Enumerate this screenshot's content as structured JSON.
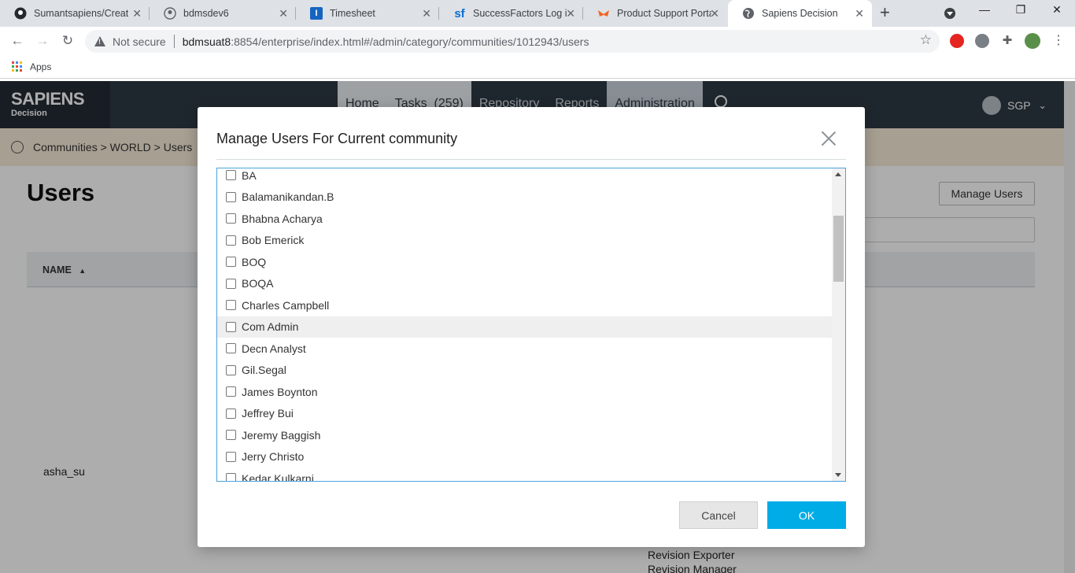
{
  "browser": {
    "tabs": [
      {
        "title": "Sumantsapiens/Create",
        "icon": "github-icon"
      },
      {
        "title": "bdmsdev6",
        "icon": "person-icon"
      },
      {
        "title": "Timesheet",
        "icon": "timesheet-icon"
      },
      {
        "title": "SuccessFactors Log in",
        "icon": "successfactors-icon"
      },
      {
        "title": "Product Support Porta",
        "icon": "support-portal-icon"
      },
      {
        "title": "Sapiens Decision",
        "icon": "globe-icon"
      }
    ],
    "address": {
      "security_label": "Not secure",
      "url_host": "bdmsuat8",
      "url_rest": ":8854/enterprise/index.html#/admin/category/communities/1012943/users"
    },
    "bookmarks": {
      "apps_label": "Apps"
    }
  },
  "app": {
    "logo_name": "SAPIENS",
    "logo_sub": "Decision",
    "nav": {
      "home": "Home",
      "tasks": "Tasks",
      "tasks_count": "(259)",
      "repository": "Repository",
      "reports": "Reports",
      "administration": "Administration"
    },
    "user_code": "SGP",
    "breadcrumb": "Communities > WORLD > Users",
    "page_title": "Users",
    "manage_users_button": "Manage Users",
    "table_header_name": "NAME",
    "row_user": "asha_su",
    "roles": [
      "Revision Exporter",
      "Revision Manager"
    ]
  },
  "modal": {
    "title": "Manage Users For Current community",
    "users": [
      {
        "name": "BA",
        "checked": false
      },
      {
        "name": "Balamanikandan.B",
        "checked": false
      },
      {
        "name": "Bhabna Acharya",
        "checked": false
      },
      {
        "name": "Bob Emerick",
        "checked": false
      },
      {
        "name": "BOQ",
        "checked": false
      },
      {
        "name": "BOQA",
        "checked": false
      },
      {
        "name": "Charles Campbell",
        "checked": false
      },
      {
        "name": "Com Admin",
        "checked": false
      },
      {
        "name": "Decn Analyst",
        "checked": false
      },
      {
        "name": "Gil.Segal",
        "checked": false
      },
      {
        "name": "James Boynton",
        "checked": false
      },
      {
        "name": "Jeffrey Bui",
        "checked": false
      },
      {
        "name": "Jeremy Baggish",
        "checked": false
      },
      {
        "name": "Jerry Christo",
        "checked": false
      },
      {
        "name": "Kedar Kulkarni",
        "checked": false
      }
    ],
    "hovered_user": "Com Admin",
    "cancel_label": "Cancel",
    "ok_label": "OK"
  },
  "colors": {
    "accent": "#00ace6",
    "header_bg": "#2f3a44",
    "breadcrumb_bg": "#f7ead8",
    "listbox_border": "#4aa3df"
  }
}
